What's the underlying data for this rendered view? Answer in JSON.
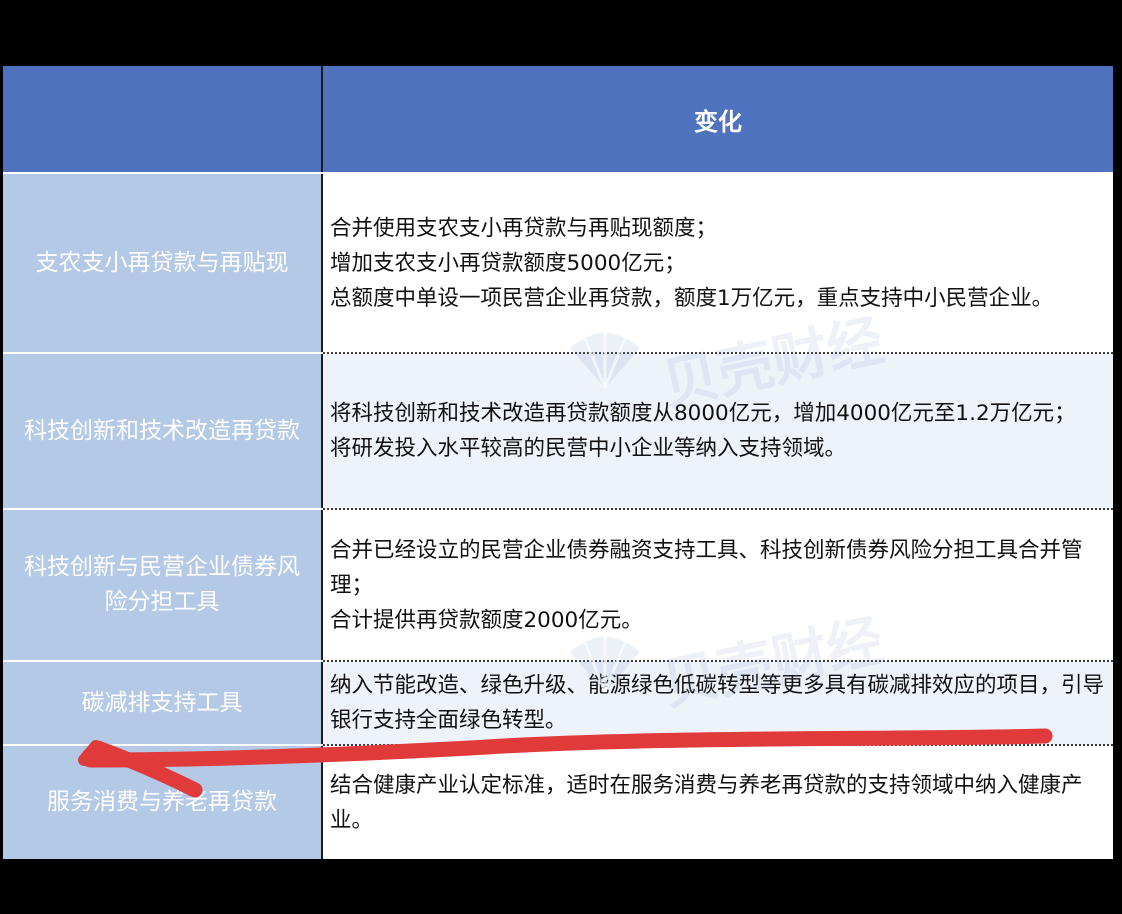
{
  "table": {
    "header": {
      "left": "",
      "right": "变化"
    },
    "rows": [
      {
        "name": "支农支小再贷款与再贴现",
        "lines": [
          "合并使用支农支小再贷款与再贴现额度；",
          "增加支农支小再贷款额度5000亿元；",
          "总额度中单设一项民营企业再贷款，额度1万亿元，重点支持中小民营企业。"
        ]
      },
      {
        "name": "科技创新和技术改造再贷款",
        "lines": [
          "将科技创新和技术改造再贷款额度从8000亿元，增加4000亿元至1.2万亿元；",
          "将研发投入水平较高的民营中小企业等纳入支持领域。"
        ]
      },
      {
        "name": "科技创新与民营企业债券风险分担工具",
        "lines": [
          "合并已经设立的民营企业债券融资支持工具、科技创新债券风险分担工具合并管理；",
          "合计提供再贷款额度2000亿元。"
        ]
      },
      {
        "name": "碳减排支持工具",
        "lines": [
          "纳入节能改造、绿色升级、能源绿色低碳转型等更多具有碳减排效应的项目，引导银行支持全面绿色转型。"
        ]
      },
      {
        "name": "服务消费与养老再贷款",
        "lines": [
          "结合健康产业认定标准，适时在服务消费与养老再贷款的支持领域中纳入健康产业。"
        ]
      }
    ]
  },
  "watermark": {
    "text": "贝壳财经"
  },
  "colors": {
    "header_bg": "#4f72be",
    "name_cell_bg": "#b4c9e5",
    "alt_row_bg": "#eef2f9",
    "annotation_stroke": "#e03a3a"
  }
}
